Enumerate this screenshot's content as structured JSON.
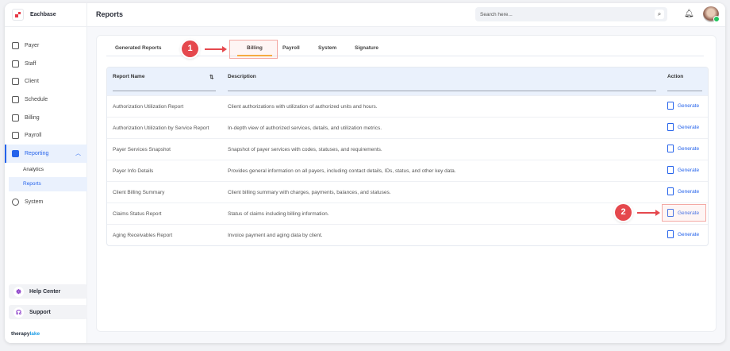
{
  "app": {
    "name": "Eachbase",
    "footer_brand_a": "therapy",
    "footer_brand_b": "lake"
  },
  "sidebar": {
    "items": [
      {
        "label": "Payer"
      },
      {
        "label": "Staff"
      },
      {
        "label": "Client"
      },
      {
        "label": "Schedule"
      },
      {
        "label": "Billing"
      },
      {
        "label": "Payroll"
      },
      {
        "label": "Reporting"
      },
      {
        "label": "System"
      }
    ],
    "sub": [
      {
        "label": "Analytics"
      },
      {
        "label": "Reports"
      }
    ],
    "help": "Help Center",
    "support": "Support"
  },
  "header": {
    "title": "Reports",
    "search_placeholder": "Search here..."
  },
  "tabs": [
    "Generated Reports",
    "Billing",
    "Payroll",
    "System",
    "Signature"
  ],
  "table": {
    "headers": {
      "name": "Report Name",
      "description": "Description",
      "action": "Action"
    },
    "rows": [
      {
        "name": "Authorization Utilization Report",
        "description": "Client authorizations with utilization of authorized units and hours.",
        "action": "Generate"
      },
      {
        "name": "Authorization Utilization by Service Report",
        "description": "In-depth view of authorized services, details, and utilization metrics.",
        "action": "Generate"
      },
      {
        "name": "Payer Services Snapshot",
        "description": "Snapshot of payer services with codes, statuses, and requirements.",
        "action": "Generate"
      },
      {
        "name": "Payer Info Details",
        "description": "Provides general information on all payers, including contact details, IDs, status, and other key data.",
        "action": "Generate"
      },
      {
        "name": "Client Billing Summary",
        "description": "Client billing summary with charges, payments, balances, and statuses.",
        "action": "Generate"
      },
      {
        "name": "Claims Status Report",
        "description": "Status of claims including billing information.",
        "action": "Generate"
      },
      {
        "name": "Aging Receivables Report",
        "description": "Invoice payment and aging data by client.",
        "action": "Generate"
      }
    ]
  },
  "annotations": {
    "step1": "1",
    "step2": "2"
  },
  "colors": {
    "accent": "#2563eb",
    "tab_underline": "#f5a524",
    "annotation": "#e5484d"
  }
}
